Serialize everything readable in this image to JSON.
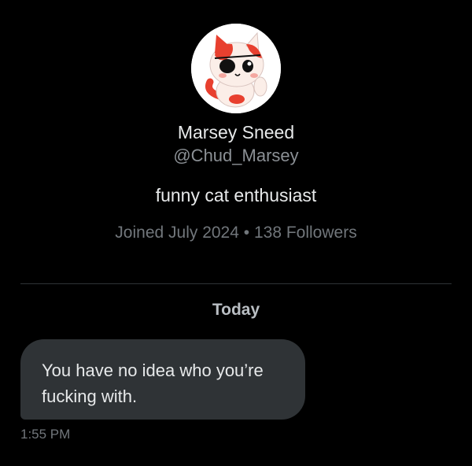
{
  "profile": {
    "name": "Marsey Sneed",
    "handle": "@Chud_Marsey",
    "bio": "funny cat enthusiast",
    "joined": "Joined July 2024",
    "separator": "•",
    "followers": "138 Followers",
    "avatar_icon": "cartoon-cat-avatar-icon"
  },
  "conversation": {
    "day_label": "Today",
    "messages": [
      {
        "text": "You have no idea who you’re fucking with.",
        "time": "1:55 PM"
      }
    ]
  },
  "colors": {
    "background": "#000000",
    "bubble": "#2f3336",
    "primary_text": "#e7e9ea",
    "secondary_text": "#71767b"
  }
}
